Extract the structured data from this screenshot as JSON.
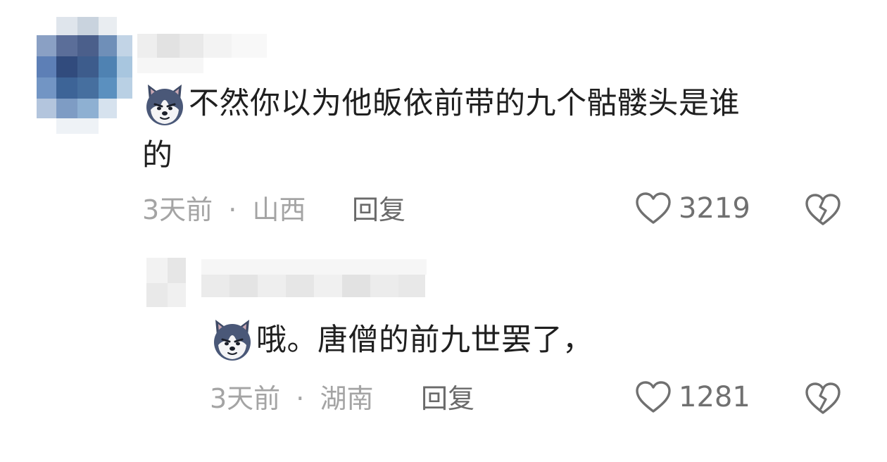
{
  "comments": [
    {
      "text_line1": "不然你以为他皈依前带的九个骷髅头是谁",
      "text_line2": "的",
      "time": "3天前",
      "separator": "·",
      "location": "山西",
      "reply_label": "回复",
      "likes": "3219",
      "emoji": "husky-emoji"
    },
    {
      "text": "哦。唐僧的前九世罢了，",
      "time": "3天前",
      "separator": "·",
      "location": "湖南",
      "reply_label": "回复",
      "likes": "1281",
      "emoji": "husky-emoji"
    }
  ],
  "icons": {
    "like": "heart-outline-icon",
    "dislike": "broken-heart-icon"
  },
  "colors": {
    "text": "#1f1f1f",
    "meta": "#a4a4a4",
    "icon": "#707070"
  }
}
